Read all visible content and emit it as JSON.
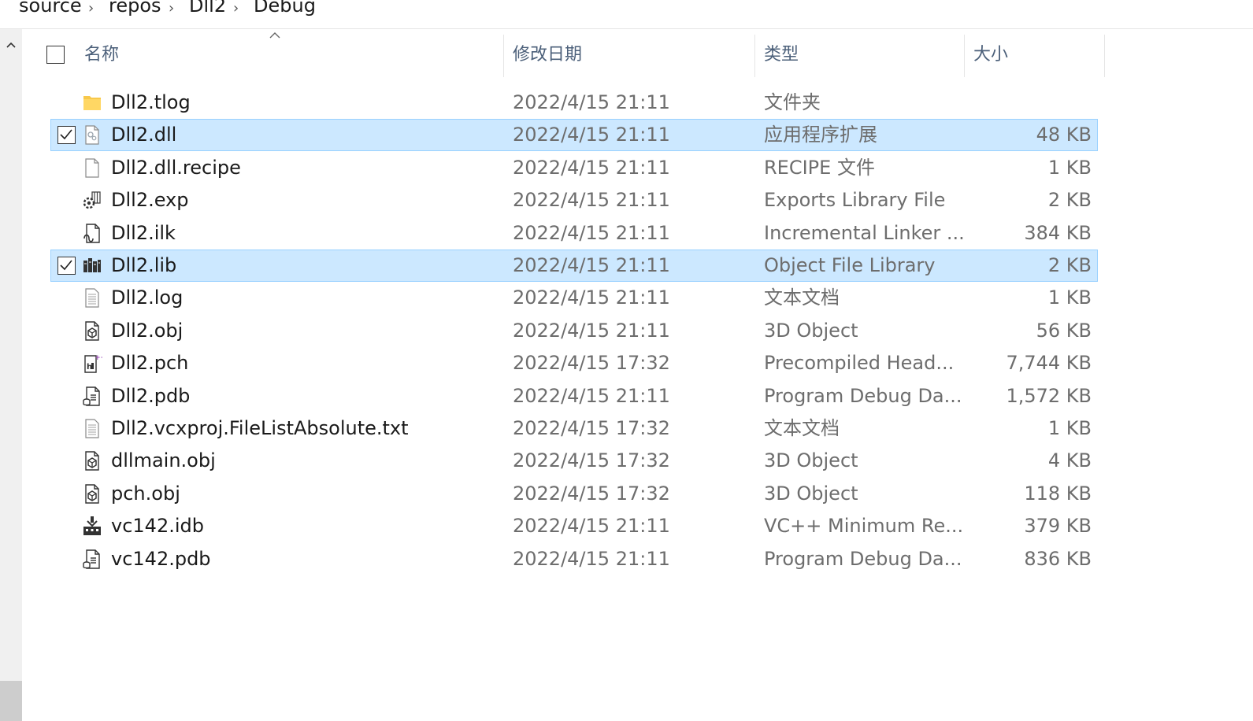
{
  "breadcrumb": {
    "items": [
      "source",
      "repos",
      "Dll2",
      "Debug"
    ],
    "separator": "›"
  },
  "columns": {
    "name": "名称",
    "date": "修改日期",
    "type": "类型",
    "size": "大小"
  },
  "files": [
    {
      "name": "Dll2.tlog",
      "date": "2022/4/15 21:11",
      "type": "文件夹",
      "size": "",
      "icon": "folder-icon",
      "selected": false
    },
    {
      "name": "Dll2.dll",
      "date": "2022/4/15 21:11",
      "type": "应用程序扩展",
      "size": "48 KB",
      "icon": "dll-file-icon",
      "selected": true
    },
    {
      "name": "Dll2.dll.recipe",
      "date": "2022/4/15 21:11",
      "type": "RECIPE 文件",
      "size": "1 KB",
      "icon": "blank-file-icon",
      "selected": false
    },
    {
      "name": "Dll2.exp",
      "date": "2022/4/15 21:11",
      "type": "Exports Library File",
      "size": "2 KB",
      "icon": "gear-library-icon",
      "selected": false
    },
    {
      "name": "Dll2.ilk",
      "date": "2022/4/15 21:11",
      "type": "Incremental Linker ...",
      "size": "384 KB",
      "icon": "linker-file-icon",
      "selected": false
    },
    {
      "name": "Dll2.lib",
      "date": "2022/4/15 21:11",
      "type": "Object File Library",
      "size": "2 KB",
      "icon": "library-books-icon",
      "selected": true
    },
    {
      "name": "Dll2.log",
      "date": "2022/4/15 21:11",
      "type": "文本文档",
      "size": "1 KB",
      "icon": "text-file-icon",
      "selected": false
    },
    {
      "name": "Dll2.obj",
      "date": "2022/4/15 21:11",
      "type": "3D Object",
      "size": "56 KB",
      "icon": "3d-object-icon",
      "selected": false
    },
    {
      "name": "Dll2.pch",
      "date": "2022/4/15 17:32",
      "type": "Precompiled Head...",
      "size": "7,744 KB",
      "icon": "precompiled-header-icon",
      "selected": false
    },
    {
      "name": "Dll2.pdb",
      "date": "2022/4/15 21:11",
      "type": "Program Debug Da...",
      "size": "1,572 KB",
      "icon": "debug-database-icon",
      "selected": false
    },
    {
      "name": "Dll2.vcxproj.FileListAbsolute.txt",
      "date": "2022/4/15 17:32",
      "type": "文本文档",
      "size": "1 KB",
      "icon": "text-file-icon",
      "selected": false
    },
    {
      "name": "dllmain.obj",
      "date": "2022/4/15 17:32",
      "type": "3D Object",
      "size": "4 KB",
      "icon": "3d-object-icon",
      "selected": false
    },
    {
      "name": "pch.obj",
      "date": "2022/4/15 17:32",
      "type": "3D Object",
      "size": "118 KB",
      "icon": "3d-object-icon",
      "selected": false
    },
    {
      "name": "vc142.idb",
      "date": "2022/4/15 21:11",
      "type": "VC++ Minimum Re...",
      "size": "379 KB",
      "icon": "rebuild-database-icon",
      "selected": false
    },
    {
      "name": "vc142.pdb",
      "date": "2022/4/15 21:11",
      "type": "Program Debug Da...",
      "size": "836 KB",
      "icon": "debug-database-icon",
      "selected": false
    }
  ],
  "colors": {
    "selection_bg": "#cce8ff",
    "selection_border": "#99d1ff",
    "header_text": "#4c607a",
    "secondary_text": "#6d6d6d"
  }
}
